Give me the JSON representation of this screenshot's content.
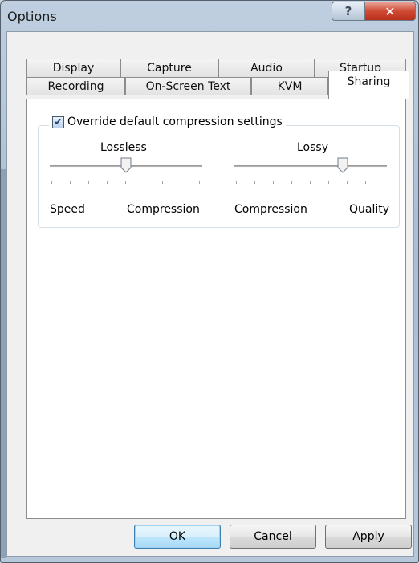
{
  "window": {
    "title": "Options"
  },
  "titlebar": {
    "help_label": "?",
    "close_label": "✕"
  },
  "tabs": {
    "row1": [
      "Display",
      "Capture",
      "Audio",
      "Startup"
    ],
    "row2": [
      "Recording",
      "On-Screen Text",
      "KVM",
      "Sharing"
    ],
    "active": "Sharing"
  },
  "sharing": {
    "override_checkbox": {
      "label": "Override default compression settings",
      "checked": true
    },
    "lossless_slider": {
      "label": "Lossless",
      "left_label": "Speed",
      "right_label": "Compression",
      "value": 0.5
    },
    "lossy_slider": {
      "label": "Lossy",
      "left_label": "Compression",
      "right_label": "Quality",
      "value": 0.75
    }
  },
  "buttons": {
    "ok": "OK",
    "cancel": "Cancel",
    "apply": "Apply"
  },
  "icons": {
    "help": "help-icon",
    "close": "close-icon",
    "check": "checkmark-icon"
  },
  "colors": {
    "close_button": "#c7432e",
    "default_button_border": "#3c7fb1",
    "checkbox_check": "#1f3e74"
  }
}
